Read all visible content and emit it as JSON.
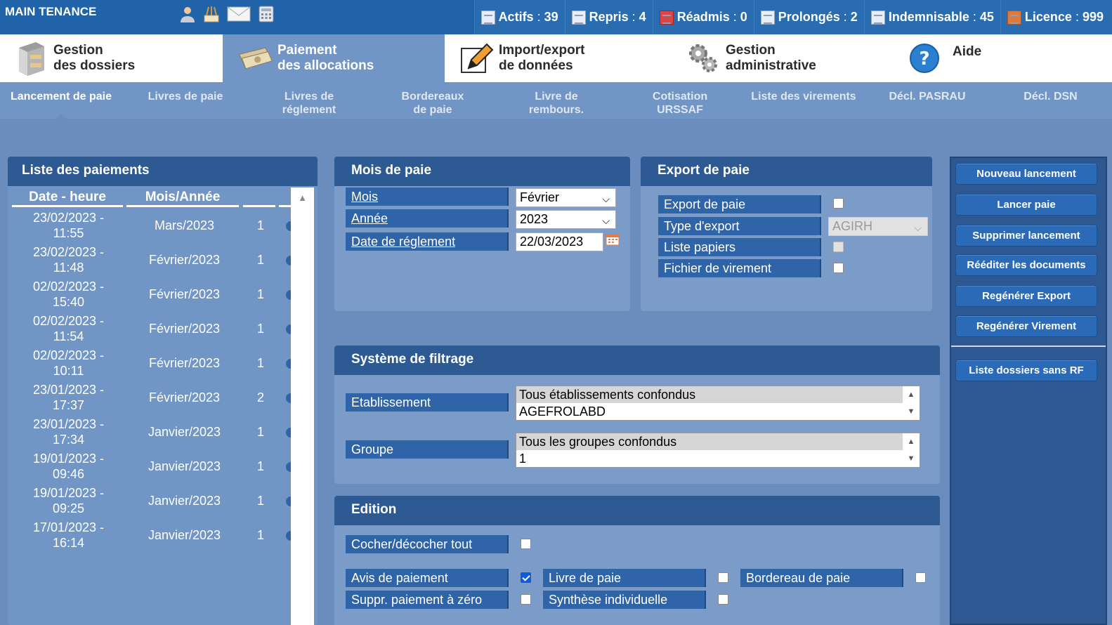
{
  "app": {
    "title": "MAIN TENANCE"
  },
  "top_icons": [
    "user-icon",
    "tools-icon",
    "mail-icon",
    "calculator-icon"
  ],
  "stats": [
    {
      "icon": "list-icon",
      "label": "Actifs",
      "value": "39"
    },
    {
      "icon": "repeat-icon",
      "label": "Repris",
      "value": "4"
    },
    {
      "icon": "readmit-icon",
      "label": "Réadmis",
      "value": "0"
    },
    {
      "icon": "extend-icon",
      "label": "Prolongés",
      "value": "2"
    },
    {
      "icon": "check-doc-icon",
      "label": "Indemnisable",
      "value": "45"
    },
    {
      "icon": "license-icon",
      "label": "Licence",
      "value": "999"
    }
  ],
  "main_menu": [
    {
      "line1": "Gestion",
      "line2": "des dossiers",
      "icon": "cabinet-icon",
      "active": false
    },
    {
      "line1": "Paiement",
      "line2": "des allocations",
      "icon": "money-icon",
      "active": true
    },
    {
      "line1": "Import/export",
      "line2": "de données",
      "icon": "edit-icon",
      "active": false
    },
    {
      "line1": "Gestion",
      "line2": "administrative",
      "icon": "gears-icon",
      "active": false
    },
    {
      "line1": "Aide",
      "line2": "",
      "icon": "help-icon",
      "active": false
    }
  ],
  "sub_menu": [
    {
      "line1": "Lancement de paie",
      "line2": ""
    },
    {
      "line1": "Livres de paie",
      "line2": ""
    },
    {
      "line1": "Livres de",
      "line2": "réglement"
    },
    {
      "line1": "Bordereaux",
      "line2": "de paie"
    },
    {
      "line1": "Livre de",
      "line2": "rembours."
    },
    {
      "line1": "Cotisation",
      "line2": "URSSAF"
    },
    {
      "line1": "Liste des virements",
      "line2": ""
    },
    {
      "line1": "Décl. PASRAU",
      "line2": ""
    },
    {
      "line1": "Décl. DSN",
      "line2": ""
    }
  ],
  "payments": {
    "title": "Liste des paiements",
    "columns": [
      "Date - heure",
      "Mois/Année",
      ""
    ],
    "rows": [
      {
        "date": "23/02/2023 -",
        "time": "11:55",
        "month": "Mars/2023",
        "n": "1"
      },
      {
        "date": "23/02/2023 -",
        "time": "11:48",
        "month": "Février/2023",
        "n": "1"
      },
      {
        "date": "02/02/2023 -",
        "time": "15:40",
        "month": "Février/2023",
        "n": "1"
      },
      {
        "date": "02/02/2023 -",
        "time": "11:54",
        "month": "Février/2023",
        "n": "1"
      },
      {
        "date": "02/02/2023 -",
        "time": "10:11",
        "month": "Février/2023",
        "n": "1"
      },
      {
        "date": "23/01/2023 -",
        "time": "17:37",
        "month": "Février/2023",
        "n": "2"
      },
      {
        "date": "23/01/2023 -",
        "time": "17:34",
        "month": "Janvier/2023",
        "n": "1"
      },
      {
        "date": "19/01/2023 -",
        "time": "09:46",
        "month": "Janvier/2023",
        "n": "1"
      },
      {
        "date": "19/01/2023 -",
        "time": "09:25",
        "month": "Janvier/2023",
        "n": "1"
      },
      {
        "date": "17/01/2023 -",
        "time": "16:14",
        "month": "Janvier/2023",
        "n": "1"
      }
    ]
  },
  "pay_month": {
    "title": "Mois de paie",
    "mois_label": "Mois",
    "mois_value": "Février",
    "annee_label": "Année",
    "annee_value": "2023",
    "date_label": "Date de réglement",
    "date_value": "22/03/2023"
  },
  "export": {
    "title": "Export de paie",
    "export_label": "Export de paie",
    "type_label": "Type d'export",
    "type_value": "AGIRH",
    "papers_label": "Liste papiers",
    "transfer_label": "Fichier de virement"
  },
  "filter": {
    "title": "Système de filtrage",
    "etab_label": "Etablissement",
    "etab_options": [
      "Tous établissements confondus",
      "AGEFROLABD"
    ],
    "group_label": "Groupe",
    "group_options": [
      "Tous les groupes confondus",
      "1"
    ]
  },
  "edition": {
    "title": "Edition",
    "toggle_all": "Cocher/décocher tout",
    "avis": "Avis de paiement",
    "livre": "Livre de paie",
    "bordereau": "Bordereau de paie",
    "suppr": "Suppr. paiement à zéro",
    "synthese": "Synthèse individuelle"
  },
  "actions": [
    "Nouveau lancement",
    "Lancer paie",
    "Supprimer lancement",
    "Rééditer les documents",
    "Regénérer Export",
    "Regénérer Virement",
    "Liste dossiers sans RF"
  ]
}
